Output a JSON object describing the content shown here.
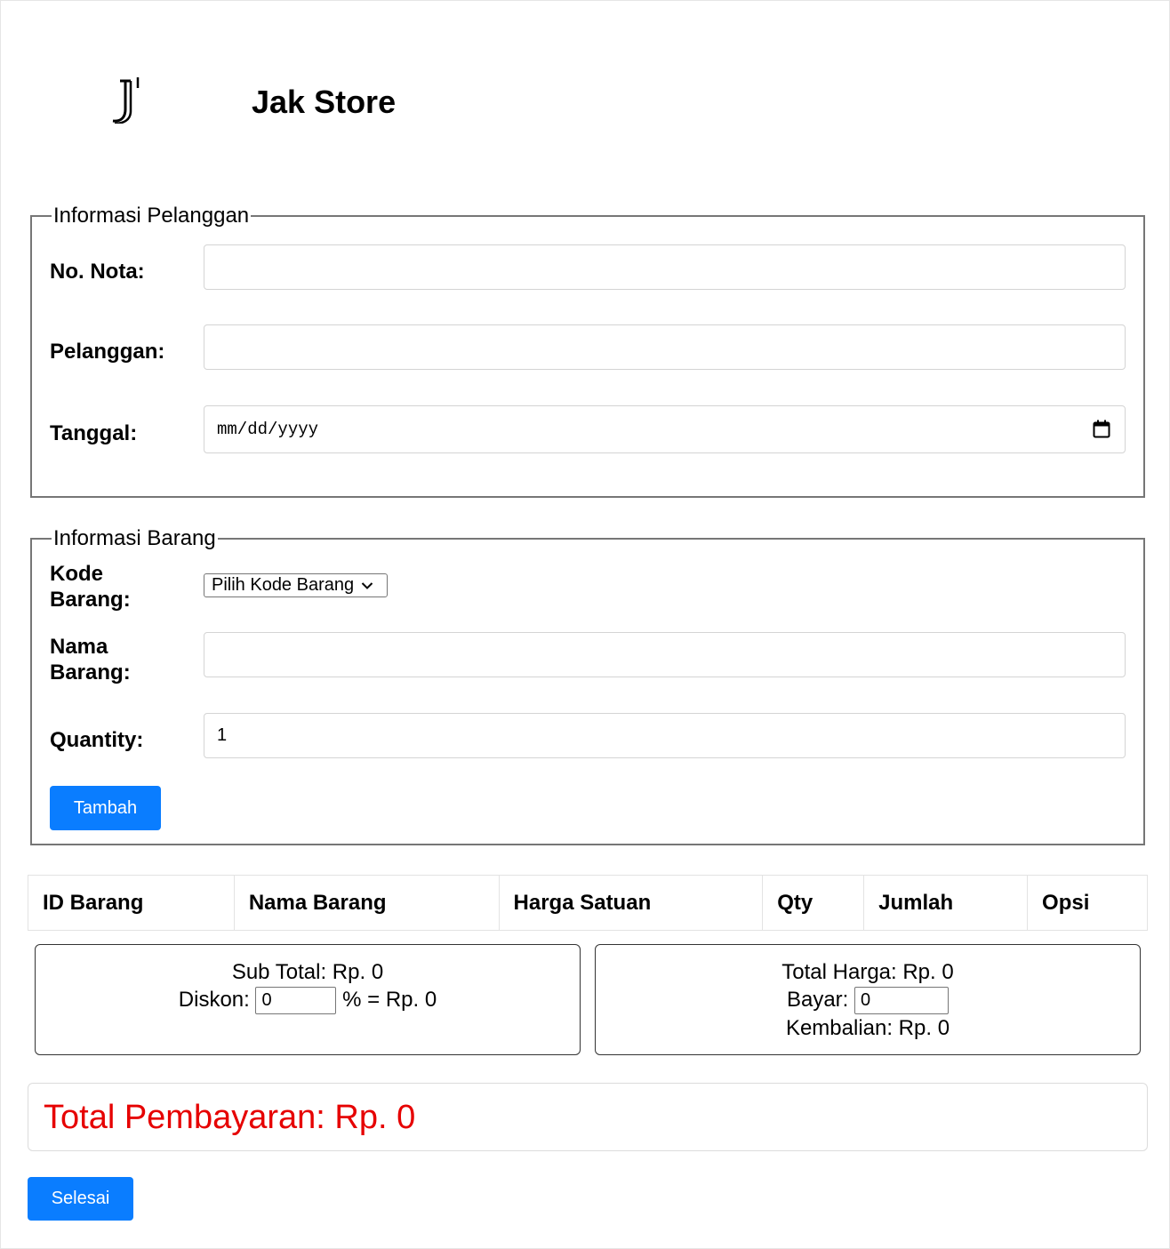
{
  "header": {
    "brand": "Jak Store",
    "logo_icon": "jak-logo-icon"
  },
  "customer": {
    "legend": "Informasi Pelanggan",
    "nota_label": "No. Nota:",
    "nota_value": "",
    "pelanggan_label": "Pelanggan:",
    "pelanggan_value": "",
    "tanggal_label": "Tanggal:",
    "tanggal_placeholder": "mm/dd/yyyy",
    "calendar_icon": "calendar-icon"
  },
  "item": {
    "legend": "Informasi Barang",
    "kode_label_1": "Kode",
    "kode_label_2": "Barang:",
    "kode_select": "Pilih Kode Barang",
    "nama_label_1": "Nama",
    "nama_label_2": "Barang:",
    "nama_value": "",
    "qty_label": "Quantity:",
    "qty_value": "1",
    "add_button": "Tambah"
  },
  "table": {
    "headers": [
      "ID Barang",
      "Nama Barang",
      "Harga Satuan",
      "Qty",
      "Jumlah",
      "Opsi"
    ]
  },
  "summary": {
    "subtotal": "Sub Total: Rp. 0",
    "diskon_label": "Diskon:",
    "diskon_value": "0",
    "diskon_result": "% = Rp. 0",
    "total_harga": "Total Harga: Rp. 0",
    "bayar_label": "Bayar:",
    "bayar_value": "0",
    "kembalian": "Kembalian: Rp. 0"
  },
  "total": {
    "text": "Total Pembayaran: Rp. 0",
    "color": "#e60000"
  },
  "finish_button": "Selesai",
  "colors": {
    "accent": "#0a7dff"
  }
}
